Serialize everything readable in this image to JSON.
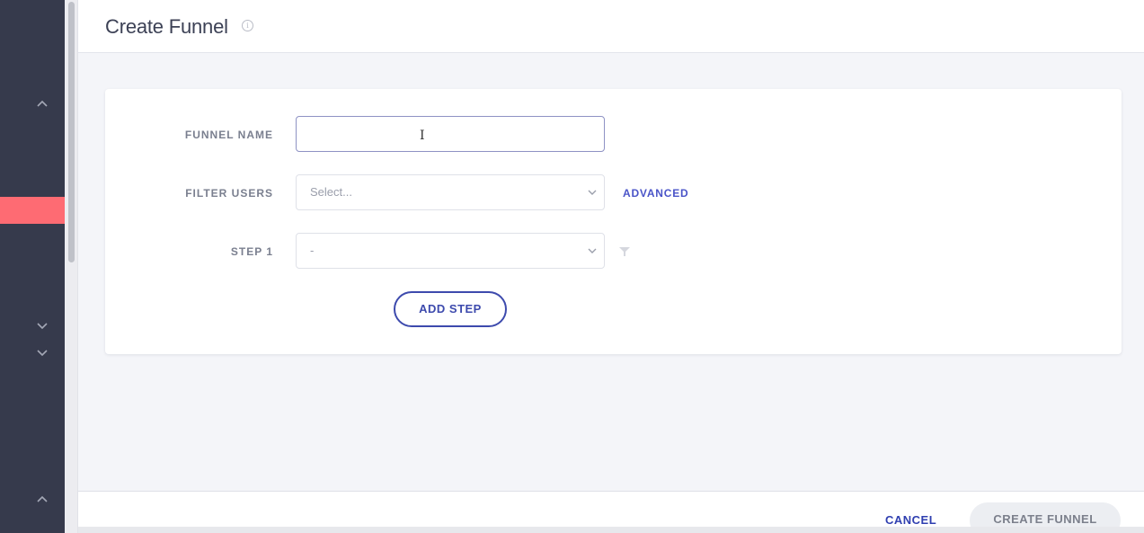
{
  "header": {
    "title": "Create Funnel",
    "info_icon": "info-icon"
  },
  "sidebar": {
    "chevrons": [
      "chevron-up-icon",
      "chevron-down-icon",
      "chevron-down-icon",
      "chevron-up-icon"
    ],
    "active_color": "#fe6b73",
    "background": "#363a4c"
  },
  "form": {
    "funnel_name": {
      "label": "FUNNEL NAME",
      "value": "",
      "placeholder": ""
    },
    "filter_users": {
      "label": "FILTER USERS",
      "placeholder": "Select...",
      "advanced_label": "ADVANCED"
    },
    "step1": {
      "label": "STEP 1",
      "value": "-"
    },
    "add_step_label": "ADD STEP"
  },
  "footer": {
    "cancel_label": "CANCEL",
    "create_label": "CREATE FUNNEL"
  },
  "colors": {
    "accent": "#3d4aad",
    "link": "#4a54c8"
  }
}
